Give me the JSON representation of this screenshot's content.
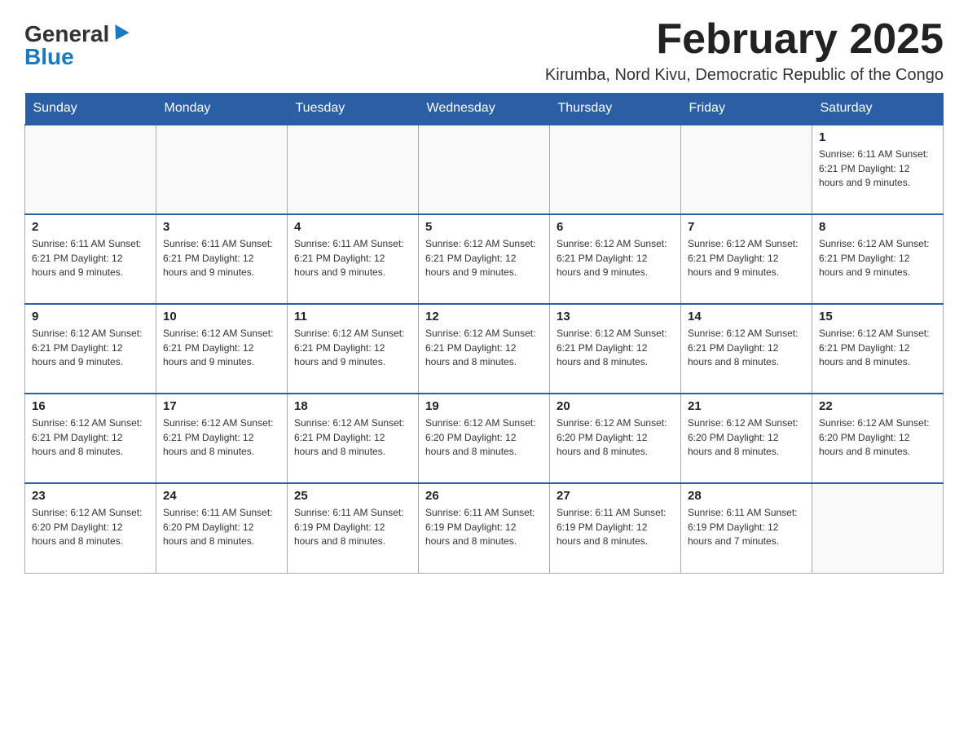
{
  "logo": {
    "general": "General",
    "blue": "Blue"
  },
  "title": "February 2025",
  "subtitle": "Kirumba, Nord Kivu, Democratic Republic of the Congo",
  "weekdays": [
    "Sunday",
    "Monday",
    "Tuesday",
    "Wednesday",
    "Thursday",
    "Friday",
    "Saturday"
  ],
  "weeks": [
    [
      {
        "day": "",
        "info": ""
      },
      {
        "day": "",
        "info": ""
      },
      {
        "day": "",
        "info": ""
      },
      {
        "day": "",
        "info": ""
      },
      {
        "day": "",
        "info": ""
      },
      {
        "day": "",
        "info": ""
      },
      {
        "day": "1",
        "info": "Sunrise: 6:11 AM\nSunset: 6:21 PM\nDaylight: 12 hours and 9 minutes."
      }
    ],
    [
      {
        "day": "2",
        "info": "Sunrise: 6:11 AM\nSunset: 6:21 PM\nDaylight: 12 hours and 9 minutes."
      },
      {
        "day": "3",
        "info": "Sunrise: 6:11 AM\nSunset: 6:21 PM\nDaylight: 12 hours and 9 minutes."
      },
      {
        "day": "4",
        "info": "Sunrise: 6:11 AM\nSunset: 6:21 PM\nDaylight: 12 hours and 9 minutes."
      },
      {
        "day": "5",
        "info": "Sunrise: 6:12 AM\nSunset: 6:21 PM\nDaylight: 12 hours and 9 minutes."
      },
      {
        "day": "6",
        "info": "Sunrise: 6:12 AM\nSunset: 6:21 PM\nDaylight: 12 hours and 9 minutes."
      },
      {
        "day": "7",
        "info": "Sunrise: 6:12 AM\nSunset: 6:21 PM\nDaylight: 12 hours and 9 minutes."
      },
      {
        "day": "8",
        "info": "Sunrise: 6:12 AM\nSunset: 6:21 PM\nDaylight: 12 hours and 9 minutes."
      }
    ],
    [
      {
        "day": "9",
        "info": "Sunrise: 6:12 AM\nSunset: 6:21 PM\nDaylight: 12 hours and 9 minutes."
      },
      {
        "day": "10",
        "info": "Sunrise: 6:12 AM\nSunset: 6:21 PM\nDaylight: 12 hours and 9 minutes."
      },
      {
        "day": "11",
        "info": "Sunrise: 6:12 AM\nSunset: 6:21 PM\nDaylight: 12 hours and 9 minutes."
      },
      {
        "day": "12",
        "info": "Sunrise: 6:12 AM\nSunset: 6:21 PM\nDaylight: 12 hours and 8 minutes."
      },
      {
        "day": "13",
        "info": "Sunrise: 6:12 AM\nSunset: 6:21 PM\nDaylight: 12 hours and 8 minutes."
      },
      {
        "day": "14",
        "info": "Sunrise: 6:12 AM\nSunset: 6:21 PM\nDaylight: 12 hours and 8 minutes."
      },
      {
        "day": "15",
        "info": "Sunrise: 6:12 AM\nSunset: 6:21 PM\nDaylight: 12 hours and 8 minutes."
      }
    ],
    [
      {
        "day": "16",
        "info": "Sunrise: 6:12 AM\nSunset: 6:21 PM\nDaylight: 12 hours and 8 minutes."
      },
      {
        "day": "17",
        "info": "Sunrise: 6:12 AM\nSunset: 6:21 PM\nDaylight: 12 hours and 8 minutes."
      },
      {
        "day": "18",
        "info": "Sunrise: 6:12 AM\nSunset: 6:21 PM\nDaylight: 12 hours and 8 minutes."
      },
      {
        "day": "19",
        "info": "Sunrise: 6:12 AM\nSunset: 6:20 PM\nDaylight: 12 hours and 8 minutes."
      },
      {
        "day": "20",
        "info": "Sunrise: 6:12 AM\nSunset: 6:20 PM\nDaylight: 12 hours and 8 minutes."
      },
      {
        "day": "21",
        "info": "Sunrise: 6:12 AM\nSunset: 6:20 PM\nDaylight: 12 hours and 8 minutes."
      },
      {
        "day": "22",
        "info": "Sunrise: 6:12 AM\nSunset: 6:20 PM\nDaylight: 12 hours and 8 minutes."
      }
    ],
    [
      {
        "day": "23",
        "info": "Sunrise: 6:12 AM\nSunset: 6:20 PM\nDaylight: 12 hours and 8 minutes."
      },
      {
        "day": "24",
        "info": "Sunrise: 6:11 AM\nSunset: 6:20 PM\nDaylight: 12 hours and 8 minutes."
      },
      {
        "day": "25",
        "info": "Sunrise: 6:11 AM\nSunset: 6:19 PM\nDaylight: 12 hours and 8 minutes."
      },
      {
        "day": "26",
        "info": "Sunrise: 6:11 AM\nSunset: 6:19 PM\nDaylight: 12 hours and 8 minutes."
      },
      {
        "day": "27",
        "info": "Sunrise: 6:11 AM\nSunset: 6:19 PM\nDaylight: 12 hours and 8 minutes."
      },
      {
        "day": "28",
        "info": "Sunrise: 6:11 AM\nSunset: 6:19 PM\nDaylight: 12 hours and 7 minutes."
      },
      {
        "day": "",
        "info": ""
      }
    ]
  ]
}
